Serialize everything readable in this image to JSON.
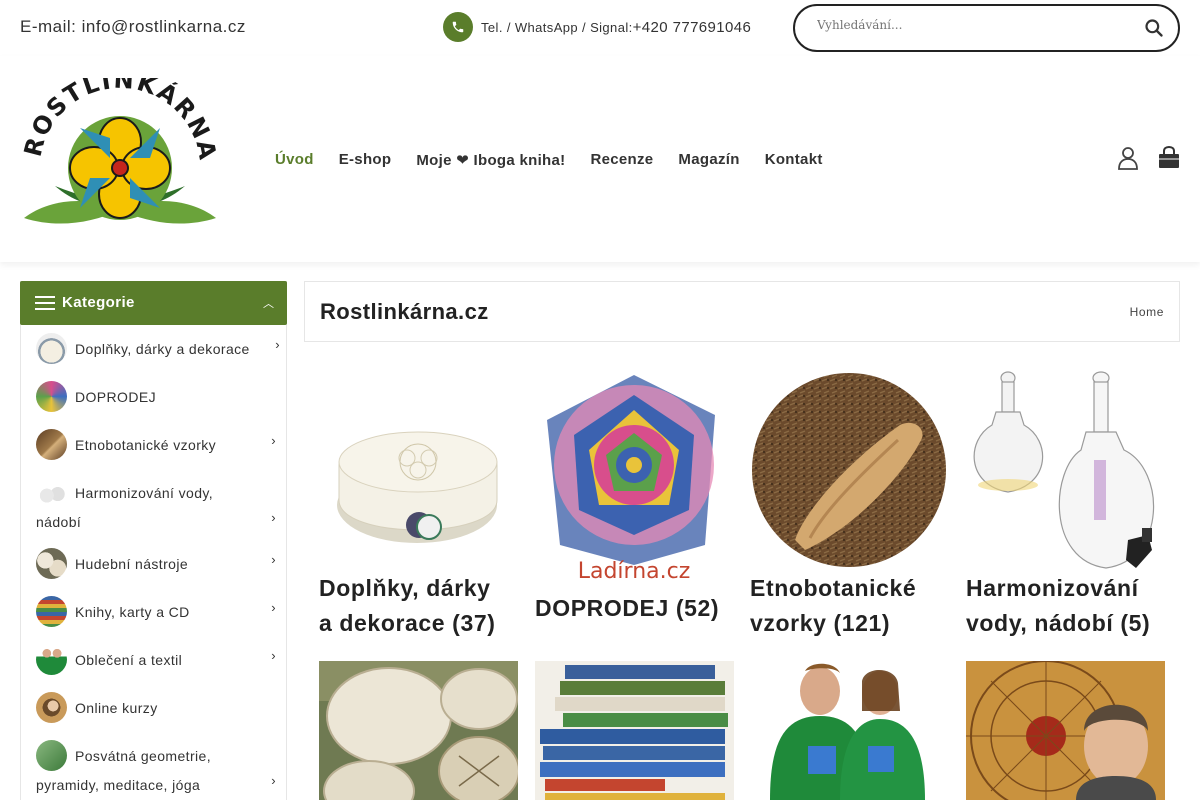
{
  "topbar": {
    "email": "E-mail: info@rostlinkarna.cz",
    "phone_label": "Tel. / WhatsApp / Signal:",
    "phone_number": "+420 777691046",
    "search_placeholder": "Vyhledávání..."
  },
  "logo": {
    "text": "ROSTLINKÁRNA"
  },
  "nav": {
    "items": [
      "Úvod",
      "E-shop",
      "Moje ❤ Iboga kniha!",
      "Recenze",
      "Magazín",
      "Kontakt"
    ],
    "active": "Úvod"
  },
  "sidebar": {
    "title": "Kategorie",
    "items": [
      {
        "label": "Doplňky, dárky a dekorace",
        "has_sub": true
      },
      {
        "label": "DOPRODEJ",
        "has_sub": false
      },
      {
        "label": "Etnobotanické vzorky",
        "has_sub": true
      },
      {
        "label": "Harmonizování vody,",
        "label2": "nádobí",
        "has_sub": true
      },
      {
        "label": "Hudební nástroje",
        "has_sub": true
      },
      {
        "label": "Knihy, karty a CD",
        "has_sub": true
      },
      {
        "label": "Oblečení a textil",
        "has_sub": true
      },
      {
        "label": "Online kurzy",
        "has_sub": false
      },
      {
        "label": "Posvátná geometrie,",
        "label2": "pyramidy, meditace, jóga",
        "has_sub": true
      }
    ]
  },
  "main": {
    "title": "Rostlinkárna.cz",
    "breadcrumb": "Home",
    "categories": [
      {
        "line1": "Doplňky, dárky",
        "line2": "a dekorace (37)"
      },
      {
        "line1": "DOPRODEJ (52)",
        "line2": "",
        "image_caption": "Ladírna.cz"
      },
      {
        "line1": "Etnobotanické",
        "line2": "vzorky (121)"
      },
      {
        "line1": "Harmonizování",
        "line2": "vody, nádobí (5)"
      }
    ]
  },
  "colors": {
    "accent": "#5a7d2b",
    "text": "#222222",
    "border": "#e6e6e6"
  }
}
